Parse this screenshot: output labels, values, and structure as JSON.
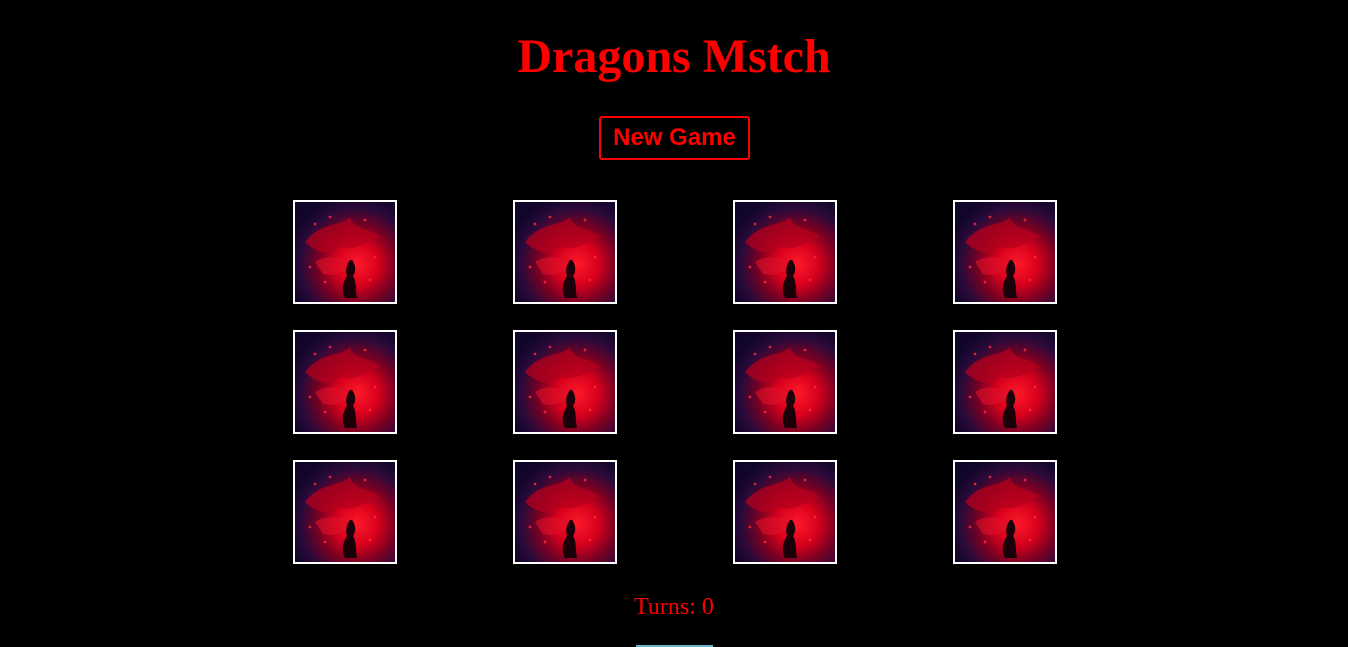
{
  "game": {
    "title": "Dragons Mstch",
    "new_game_label": "New Game",
    "turns_label": "Turns: 0",
    "turns": 0,
    "accent_color": "#ff0000",
    "card_border_color": "#ffffff",
    "background_color": "#000000",
    "cards": [
      {
        "face": "card-back",
        "flipped": false
      },
      {
        "face": "card-back",
        "flipped": false
      },
      {
        "face": "card-back",
        "flipped": false
      },
      {
        "face": "card-back",
        "flipped": false
      },
      {
        "face": "card-back",
        "flipped": false
      },
      {
        "face": "card-back",
        "flipped": false
      },
      {
        "face": "card-back",
        "flipped": false
      },
      {
        "face": "card-back",
        "flipped": false
      },
      {
        "face": "card-back",
        "flipped": false
      },
      {
        "face": "card-back",
        "flipped": false
      },
      {
        "face": "card-back",
        "flipped": false
      },
      {
        "face": "card-back",
        "flipped": false
      }
    ]
  }
}
